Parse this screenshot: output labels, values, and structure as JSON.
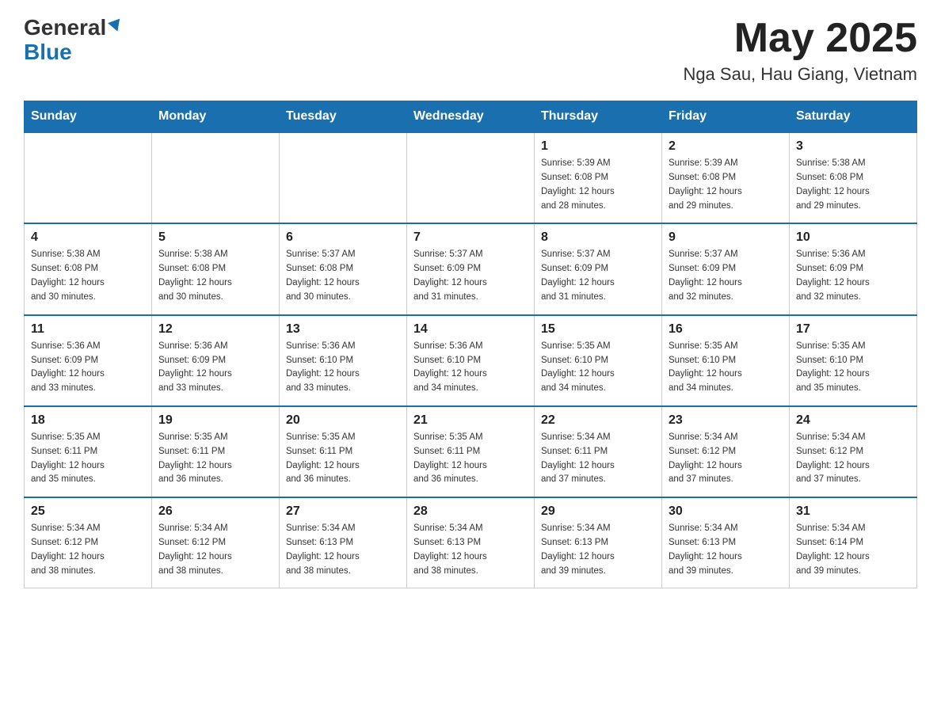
{
  "header": {
    "logo_line1": "General",
    "logo_line2": "Blue",
    "month_title": "May 2025",
    "location": "Nga Sau, Hau Giang, Vietnam"
  },
  "days_of_week": [
    "Sunday",
    "Monday",
    "Tuesday",
    "Wednesday",
    "Thursday",
    "Friday",
    "Saturday"
  ],
  "weeks": [
    [
      {
        "day": "",
        "info": ""
      },
      {
        "day": "",
        "info": ""
      },
      {
        "day": "",
        "info": ""
      },
      {
        "day": "",
        "info": ""
      },
      {
        "day": "1",
        "info": "Sunrise: 5:39 AM\nSunset: 6:08 PM\nDaylight: 12 hours\nand 28 minutes."
      },
      {
        "day": "2",
        "info": "Sunrise: 5:39 AM\nSunset: 6:08 PM\nDaylight: 12 hours\nand 29 minutes."
      },
      {
        "day": "3",
        "info": "Sunrise: 5:38 AM\nSunset: 6:08 PM\nDaylight: 12 hours\nand 29 minutes."
      }
    ],
    [
      {
        "day": "4",
        "info": "Sunrise: 5:38 AM\nSunset: 6:08 PM\nDaylight: 12 hours\nand 30 minutes."
      },
      {
        "day": "5",
        "info": "Sunrise: 5:38 AM\nSunset: 6:08 PM\nDaylight: 12 hours\nand 30 minutes."
      },
      {
        "day": "6",
        "info": "Sunrise: 5:37 AM\nSunset: 6:08 PM\nDaylight: 12 hours\nand 30 minutes."
      },
      {
        "day": "7",
        "info": "Sunrise: 5:37 AM\nSunset: 6:09 PM\nDaylight: 12 hours\nand 31 minutes."
      },
      {
        "day": "8",
        "info": "Sunrise: 5:37 AM\nSunset: 6:09 PM\nDaylight: 12 hours\nand 31 minutes."
      },
      {
        "day": "9",
        "info": "Sunrise: 5:37 AM\nSunset: 6:09 PM\nDaylight: 12 hours\nand 32 minutes."
      },
      {
        "day": "10",
        "info": "Sunrise: 5:36 AM\nSunset: 6:09 PM\nDaylight: 12 hours\nand 32 minutes."
      }
    ],
    [
      {
        "day": "11",
        "info": "Sunrise: 5:36 AM\nSunset: 6:09 PM\nDaylight: 12 hours\nand 33 minutes."
      },
      {
        "day": "12",
        "info": "Sunrise: 5:36 AM\nSunset: 6:09 PM\nDaylight: 12 hours\nand 33 minutes."
      },
      {
        "day": "13",
        "info": "Sunrise: 5:36 AM\nSunset: 6:10 PM\nDaylight: 12 hours\nand 33 minutes."
      },
      {
        "day": "14",
        "info": "Sunrise: 5:36 AM\nSunset: 6:10 PM\nDaylight: 12 hours\nand 34 minutes."
      },
      {
        "day": "15",
        "info": "Sunrise: 5:35 AM\nSunset: 6:10 PM\nDaylight: 12 hours\nand 34 minutes."
      },
      {
        "day": "16",
        "info": "Sunrise: 5:35 AM\nSunset: 6:10 PM\nDaylight: 12 hours\nand 34 minutes."
      },
      {
        "day": "17",
        "info": "Sunrise: 5:35 AM\nSunset: 6:10 PM\nDaylight: 12 hours\nand 35 minutes."
      }
    ],
    [
      {
        "day": "18",
        "info": "Sunrise: 5:35 AM\nSunset: 6:11 PM\nDaylight: 12 hours\nand 35 minutes."
      },
      {
        "day": "19",
        "info": "Sunrise: 5:35 AM\nSunset: 6:11 PM\nDaylight: 12 hours\nand 36 minutes."
      },
      {
        "day": "20",
        "info": "Sunrise: 5:35 AM\nSunset: 6:11 PM\nDaylight: 12 hours\nand 36 minutes."
      },
      {
        "day": "21",
        "info": "Sunrise: 5:35 AM\nSunset: 6:11 PM\nDaylight: 12 hours\nand 36 minutes."
      },
      {
        "day": "22",
        "info": "Sunrise: 5:34 AM\nSunset: 6:11 PM\nDaylight: 12 hours\nand 37 minutes."
      },
      {
        "day": "23",
        "info": "Sunrise: 5:34 AM\nSunset: 6:12 PM\nDaylight: 12 hours\nand 37 minutes."
      },
      {
        "day": "24",
        "info": "Sunrise: 5:34 AM\nSunset: 6:12 PM\nDaylight: 12 hours\nand 37 minutes."
      }
    ],
    [
      {
        "day": "25",
        "info": "Sunrise: 5:34 AM\nSunset: 6:12 PM\nDaylight: 12 hours\nand 38 minutes."
      },
      {
        "day": "26",
        "info": "Sunrise: 5:34 AM\nSunset: 6:12 PM\nDaylight: 12 hours\nand 38 minutes."
      },
      {
        "day": "27",
        "info": "Sunrise: 5:34 AM\nSunset: 6:13 PM\nDaylight: 12 hours\nand 38 minutes."
      },
      {
        "day": "28",
        "info": "Sunrise: 5:34 AM\nSunset: 6:13 PM\nDaylight: 12 hours\nand 38 minutes."
      },
      {
        "day": "29",
        "info": "Sunrise: 5:34 AM\nSunset: 6:13 PM\nDaylight: 12 hours\nand 39 minutes."
      },
      {
        "day": "30",
        "info": "Sunrise: 5:34 AM\nSunset: 6:13 PM\nDaylight: 12 hours\nand 39 minutes."
      },
      {
        "day": "31",
        "info": "Sunrise: 5:34 AM\nSunset: 6:14 PM\nDaylight: 12 hours\nand 39 minutes."
      }
    ]
  ]
}
